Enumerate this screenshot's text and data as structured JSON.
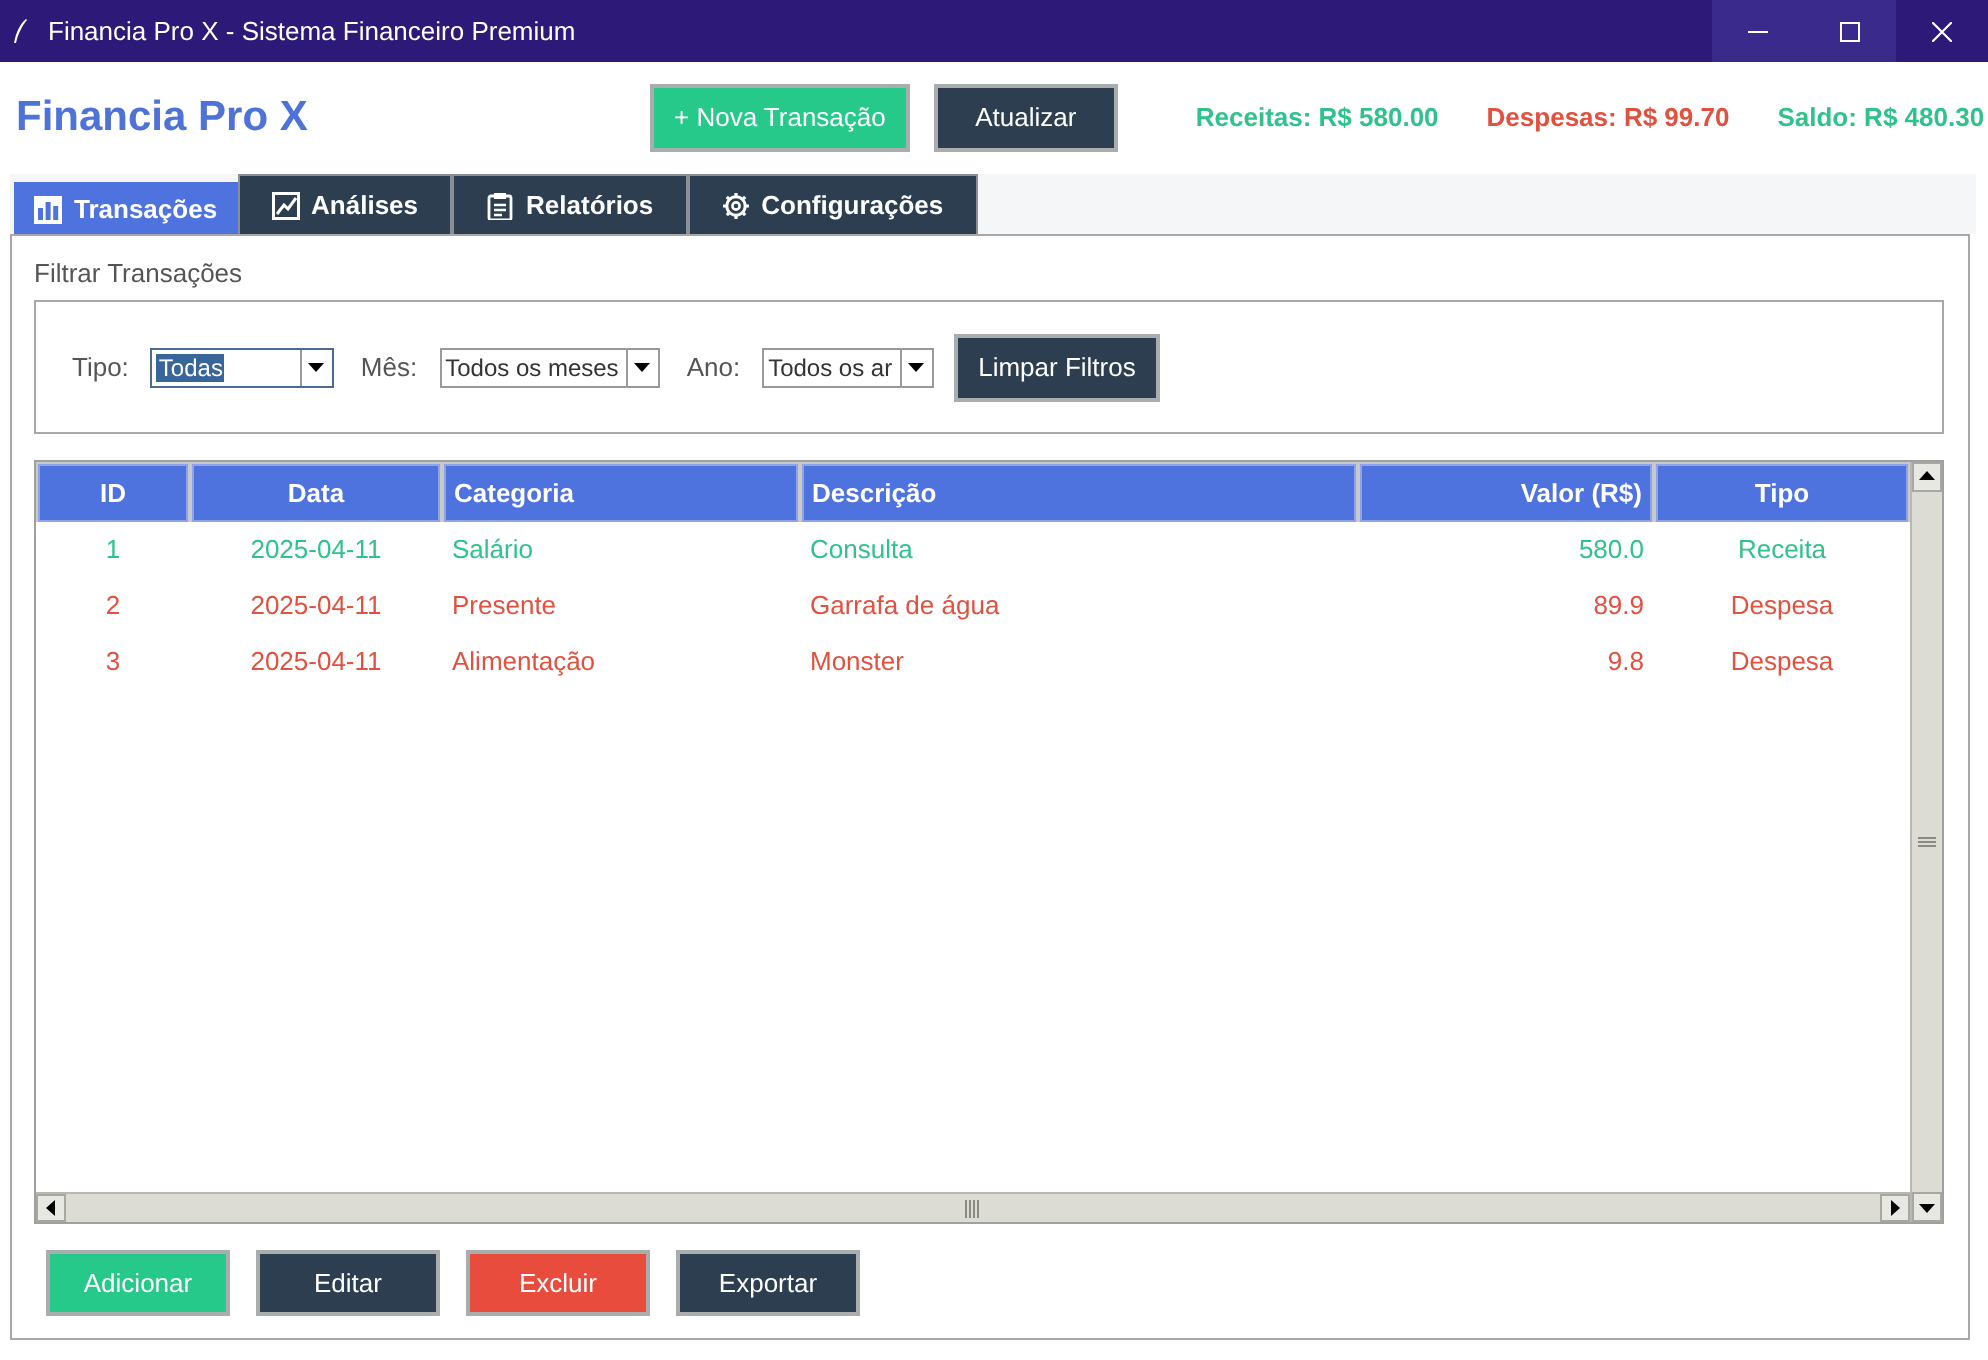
{
  "window": {
    "title": "Financia Pro X - Sistema Financeiro Premium"
  },
  "header": {
    "app_title": "Financia Pro X",
    "buttons": [
      {
        "label": "+ Nova Transação",
        "kind": "success"
      },
      {
        "label": "Atualizar",
        "kind": "dark"
      }
    ],
    "summary": [
      {
        "text": "Receitas: R$ 580.00",
        "color": "#2fc28a"
      },
      {
        "text": "Despesas: R$ 99.70",
        "color": "#e0513f"
      },
      {
        "text": "Saldo: R$ 480.30",
        "color": "#2fc28a"
      }
    ]
  },
  "tabs": [
    {
      "label": "Transações",
      "selected": true
    },
    {
      "label": "Análises",
      "selected": false
    },
    {
      "label": "Relatórios",
      "selected": false
    },
    {
      "label": "Configurações",
      "selected": false
    }
  ],
  "filter_panel": {
    "title": "Filtrar Transações",
    "filters": [
      {
        "label": "Tipo:",
        "value": "Todas",
        "focused": true
      },
      {
        "label": "Mês:",
        "value": "Todos os meses",
        "focused": false
      },
      {
        "label": "Ano:",
        "value": "Todos os ar",
        "focused": false
      }
    ],
    "clear_button": "Limpar Filtros"
  },
  "table": {
    "columns": [
      "ID",
      "Data",
      "Categoria",
      "Descrição",
      "Valor (R$)",
      "Tipo"
    ],
    "rows": [
      {
        "cells": [
          "1",
          "2025-04-11",
          "Salário",
          "Consulta",
          "580.0",
          "Receita"
        ],
        "color": "#2fc28a"
      },
      {
        "cells": [
          "2",
          "2025-04-11",
          "Presente",
          "Garrafa de água",
          "89.9",
          "Despesa"
        ],
        "color": "#e0513f"
      },
      {
        "cells": [
          "3",
          "2025-04-11",
          "Alimentação",
          "Monster",
          "9.8",
          "Despesa"
        ],
        "color": "#e0513f"
      }
    ]
  },
  "actions": [
    {
      "label": "Adicionar",
      "kind": "success"
    },
    {
      "label": "Editar",
      "kind": "dark"
    },
    {
      "label": "Excluir",
      "kind": "danger"
    },
    {
      "label": "Exportar",
      "kind": "dark"
    }
  ]
}
